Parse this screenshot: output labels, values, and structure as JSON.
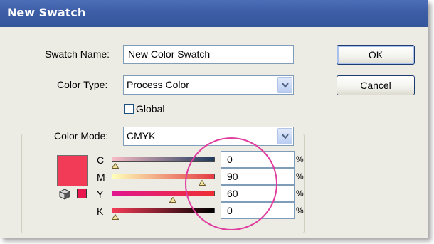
{
  "dialog": {
    "title": "New Swatch"
  },
  "form": {
    "swatch_name_label": "Swatch Name:",
    "swatch_name_value": "New Color Swatch",
    "color_type_label": "Color Type:",
    "color_type_value": "Process Color",
    "global_label": "Global",
    "global_checked": false,
    "color_mode_label": "Color Mode:",
    "color_mode_value": "CMYK"
  },
  "buttons": {
    "ok": "OK",
    "cancel": "Cancel"
  },
  "sliders": [
    {
      "label": "C",
      "value": "0",
      "unit": "%",
      "fraction": 0.0,
      "gradient": [
        "#f8bcc6",
        "#1f3a5c"
      ]
    },
    {
      "label": "M",
      "value": "90",
      "unit": "%",
      "fraction": 0.9,
      "gradient": [
        "#ffffb8",
        "#e23b44"
      ]
    },
    {
      "label": "Y",
      "value": "60",
      "unit": "%",
      "fraction": 0.6,
      "gradient": [
        "#e0178f",
        "#ee2f33"
      ]
    },
    {
      "label": "K",
      "value": "0",
      "unit": "%",
      "fraction": 0.0,
      "gradient": [
        "#f23b56",
        "#000000"
      ]
    }
  ],
  "preview": {
    "swatch_color": "#f23b56",
    "gamut_swatch_color": "#e8174f",
    "cube_icon": "out-of-web-gamut-cube-icon"
  },
  "colors": {
    "title_bar": "#3d5ea6",
    "window_bg": "#ecebe4",
    "annotation": "#df3c9e"
  }
}
